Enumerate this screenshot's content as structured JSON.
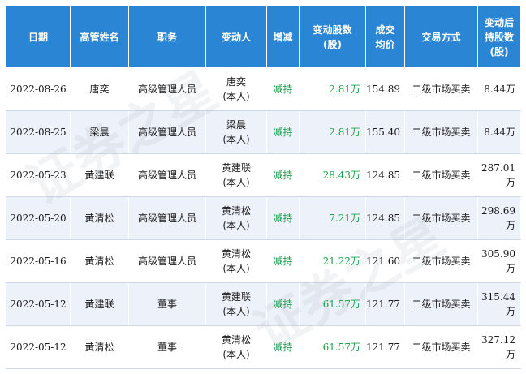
{
  "columns": [
    "日期",
    "高管姓名",
    "职务",
    "变动人",
    "增减",
    "变动股数(股)",
    "成交均价",
    "交易方式",
    "变动后持股数(股)"
  ],
  "header_lines": {
    "change_shares": [
      "变动股数",
      "(股)"
    ],
    "avg_price": [
      "成交",
      "均价"
    ],
    "after_shares": [
      "变动后",
      "持股数",
      "(股)"
    ]
  },
  "rows": [
    {
      "date": "2022-08-26",
      "name": "唐奕",
      "role": "高级管理人员",
      "changer": "唐奕",
      "relation": "(本人)",
      "direction": "减持",
      "shares": "2.81万",
      "price": "154.89",
      "method": "二级市场买卖",
      "after": "8.44万"
    },
    {
      "date": "2022-08-25",
      "name": "梁晨",
      "role": "高级管理人员",
      "changer": "梁晨",
      "relation": "(本人)",
      "direction": "减持",
      "shares": "2.81万",
      "price": "155.40",
      "method": "二级市场买卖",
      "after": "8.44万"
    },
    {
      "date": "2022-05-23",
      "name": "黄建联",
      "role": "高级管理人员",
      "changer": "黄建联",
      "relation": "(本人)",
      "direction": "减持",
      "shares": "28.43万",
      "price": "124.85",
      "method": "二级市场买卖",
      "after": "287.01万"
    },
    {
      "date": "2022-05-20",
      "name": "黄清松",
      "role": "高级管理人员",
      "changer": "黄清松",
      "relation": "(本人)",
      "direction": "减持",
      "shares": "7.21万",
      "price": "124.85",
      "method": "二级市场买卖",
      "after": "298.69万"
    },
    {
      "date": "2022-05-16",
      "name": "黄清松",
      "role": "高级管理人员",
      "changer": "黄清松",
      "relation": "(本人)",
      "direction": "减持",
      "shares": "21.22万",
      "price": "121.60",
      "method": "二级市场买卖",
      "after": "305.90万"
    },
    {
      "date": "2022-05-12",
      "name": "黄建联",
      "role": "董事",
      "changer": "黄建联",
      "relation": "(本人)",
      "direction": "减持",
      "shares": "61.57万",
      "price": "121.77",
      "method": "二级市场买卖",
      "after": "315.44万"
    },
    {
      "date": "2022-05-12",
      "name": "黄清松",
      "role": "董事",
      "changer": "黄清松",
      "relation": "(本人)",
      "direction": "减持",
      "shares": "61.57万",
      "price": "121.77",
      "method": "二级市场买卖",
      "after": "327.12万"
    }
  ],
  "watermark": [
    "证券之星",
    "证券之星"
  ],
  "colors": {
    "header": "#2a86d4",
    "stripe": "#edf1f9",
    "decrease": "#1aa34a"
  }
}
